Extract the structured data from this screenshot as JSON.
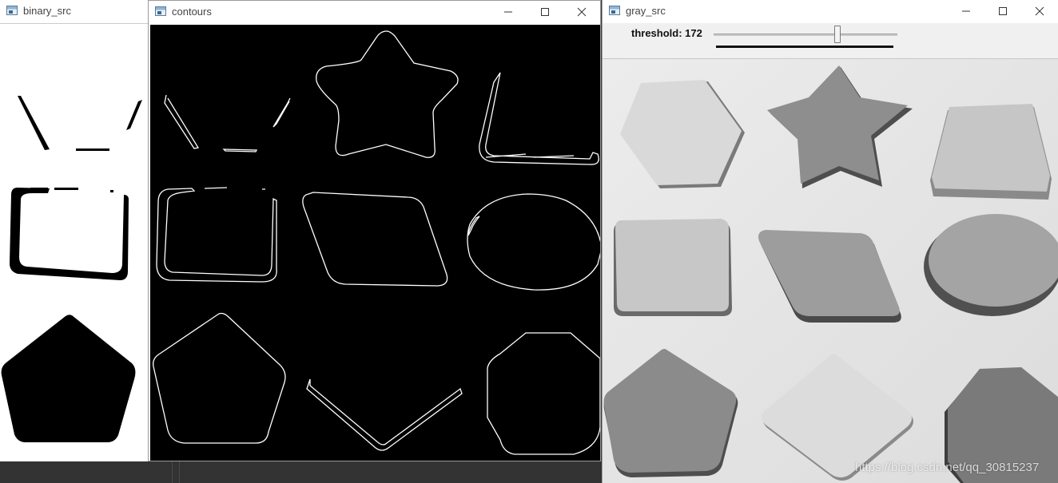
{
  "windows": {
    "binary_src": {
      "title": "binary_src"
    },
    "contours": {
      "title": "contours"
    },
    "gray_src": {
      "title": "gray_src"
    }
  },
  "trackbar": {
    "label": "threshold: 172",
    "value": 172,
    "max": 255
  },
  "watermark": "https://blog.csdn.net/qq_30815237",
  "icons": {
    "minimize": "minimize-icon",
    "maximize": "maximize-icon",
    "close": "close-icon"
  },
  "colors": {
    "contour_bg": "#000000",
    "contour_line": "#ffffff",
    "gray_bg": "#e4e4e4"
  }
}
